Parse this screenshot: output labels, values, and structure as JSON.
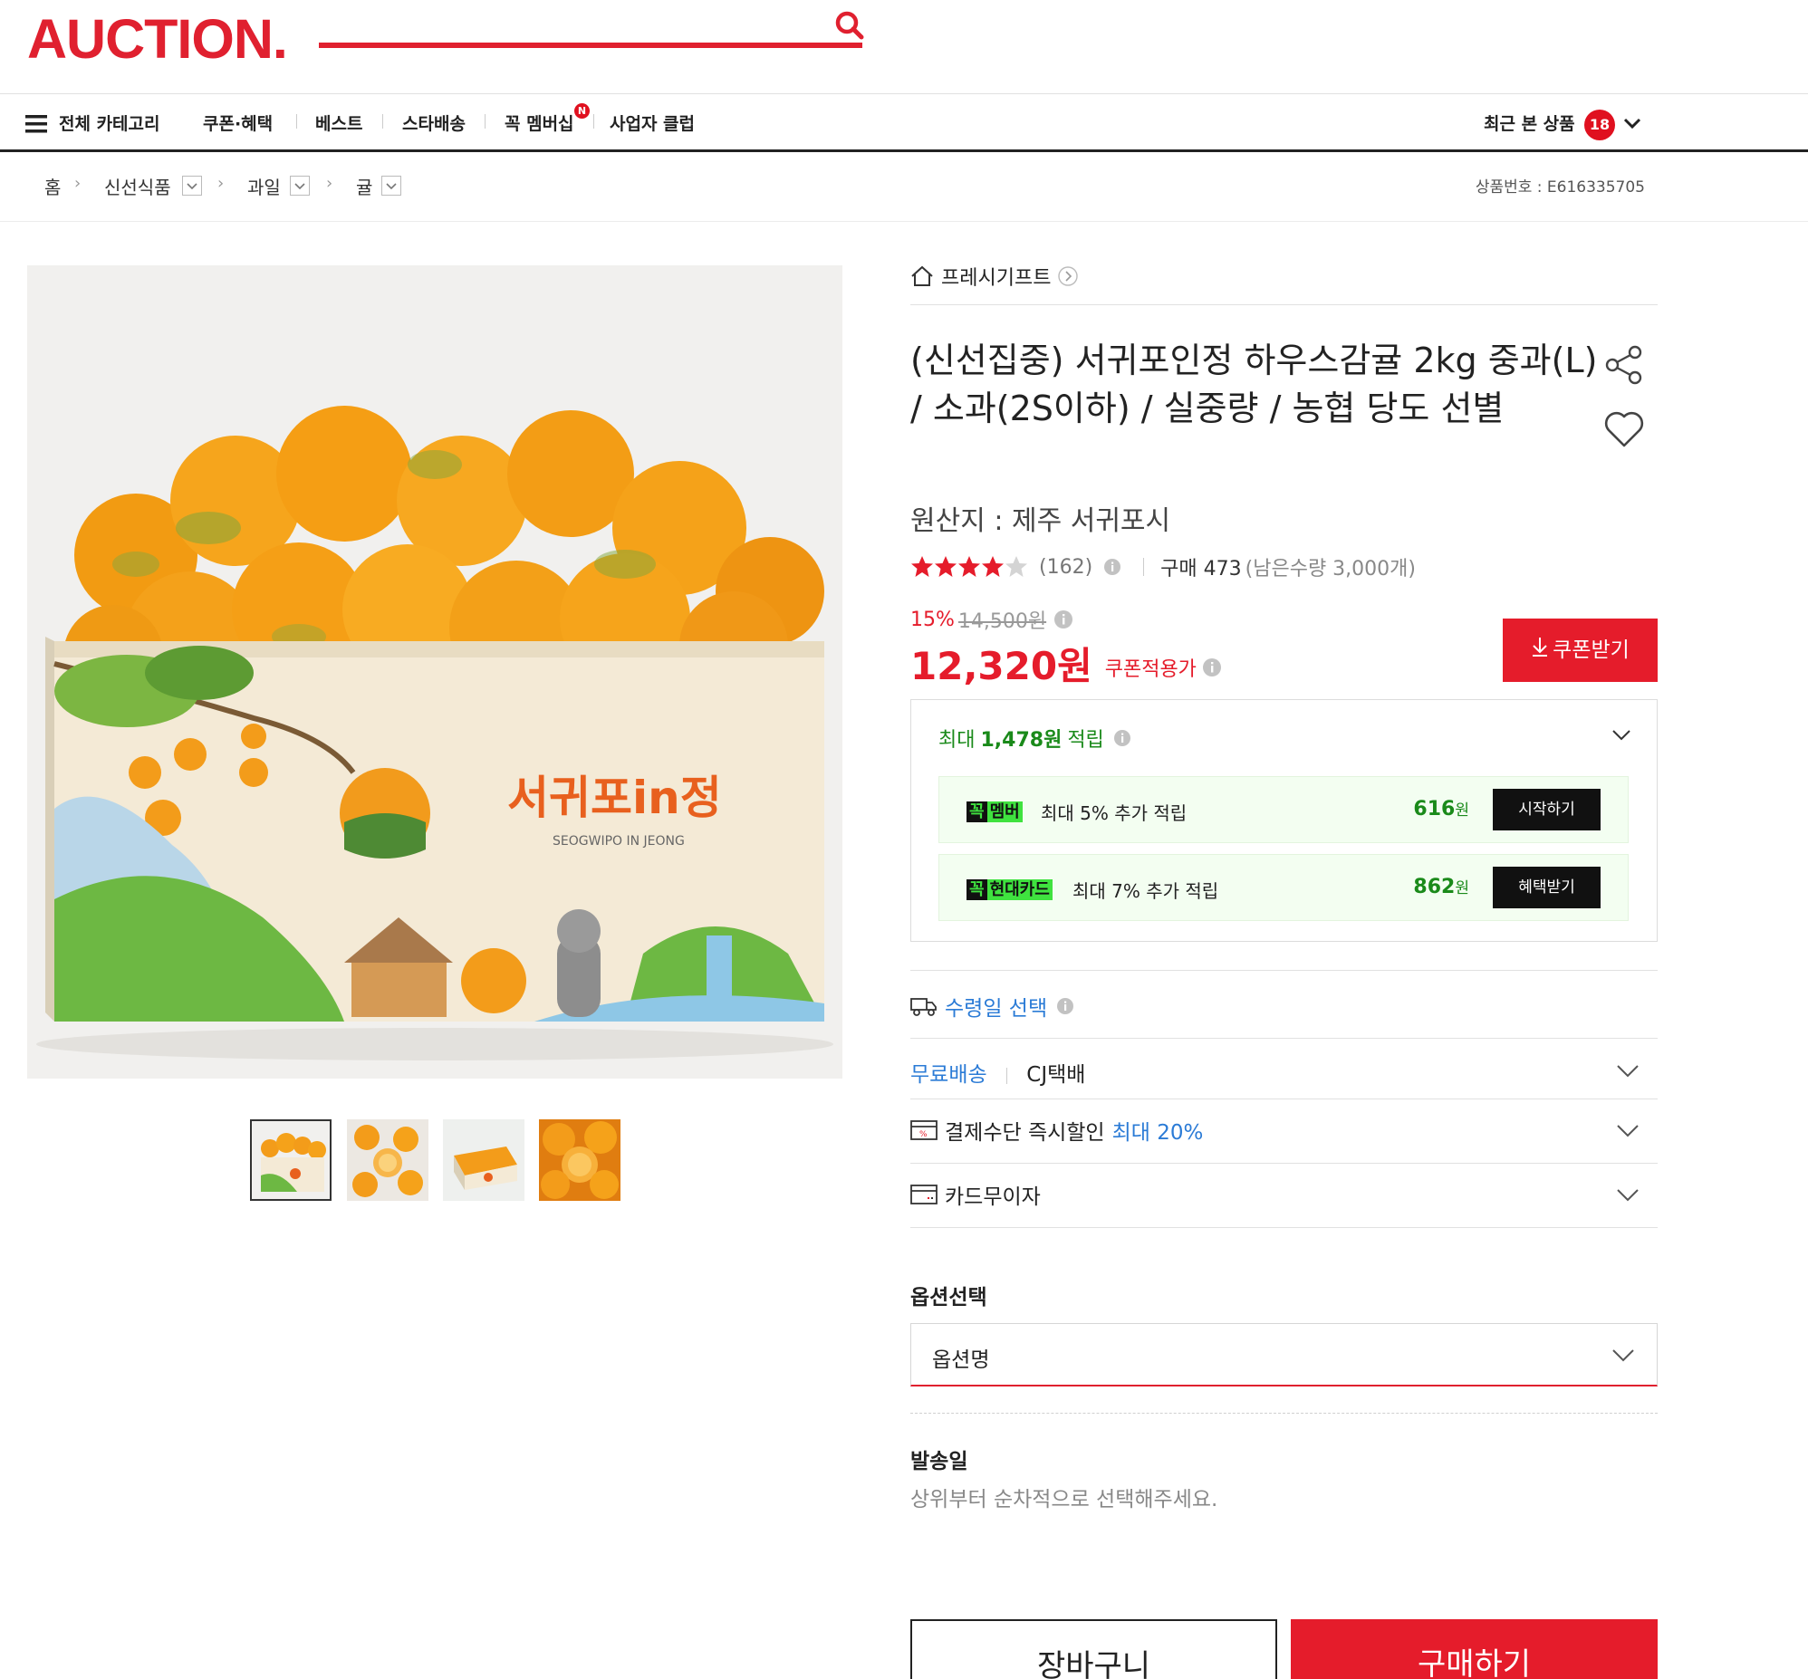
{
  "header": {
    "logo": "AUCTION.",
    "nav": {
      "all_categories": "전체 카테고리",
      "items": [
        "쿠폰·혜택",
        "베스트",
        "스타배송",
        "꼭 멤버십",
        "사업자 클럽"
      ],
      "new_badge": "N",
      "recent_label": "최근 본 상품",
      "recent_count": "18"
    }
  },
  "breadcrumb": {
    "home": "홈",
    "levels": [
      "신선식품",
      "과일",
      "귤"
    ],
    "item_number": "상품번호 : E616335705"
  },
  "gallery": {
    "box_brand": "서귀포in정",
    "box_brand_en": "SEOGWIPO IN JEONG",
    "thumbnail_count": 4
  },
  "product": {
    "store": "프레시기프트",
    "title": "(신선집중) 서귀포인정 하우스감귤 2kg 중과(L) / 소과(2S이하) / 실중량 / 농협 당도 선별",
    "origin": "원산지 : 제주 서귀포시",
    "rating_stars": 4,
    "review_count": "(162)",
    "purchase": "구매 473",
    "remaining": "(남은수량 3,000개)",
    "discount": "15%",
    "original_price": "14,500원",
    "price": "12,320원",
    "price_label": "쿠폰적용가",
    "coupon_button": "쿠폰받기"
  },
  "points": {
    "prefix": "최대",
    "amount": "1,478원",
    "suffix": "적립",
    "promos": [
      {
        "badge_a": "꼭",
        "badge_b": "멤버",
        "text": "최대 5% 추가 적립",
        "amount": "616",
        "unit": "원",
        "button": "시작하기"
      },
      {
        "badge_a": "꼭",
        "badge_b": "현대카드",
        "text": "최대 7% 추가 적립",
        "amount": "862",
        "unit": "원",
        "button": "혜택받기"
      }
    ]
  },
  "delivery": {
    "date_select": "수령일 선택",
    "free_shipping": "무료배송",
    "courier": "CJ택배",
    "payment_discount": "결제수단 즉시할인",
    "payment_discount_max": "최대 20%",
    "installment": "카드무이자"
  },
  "options": {
    "label": "옵션선택",
    "placeholder": "옵션명"
  },
  "shipping": {
    "label": "발송일",
    "desc": "상위부터 순차적으로 선택해주세요."
  },
  "actions": {
    "cart": "장바구니",
    "buy": "구매하기"
  },
  "colors": {
    "brand_red": "#e0202f",
    "point_green": "#1a8a1a",
    "link_blue": "#2b7bd6"
  }
}
